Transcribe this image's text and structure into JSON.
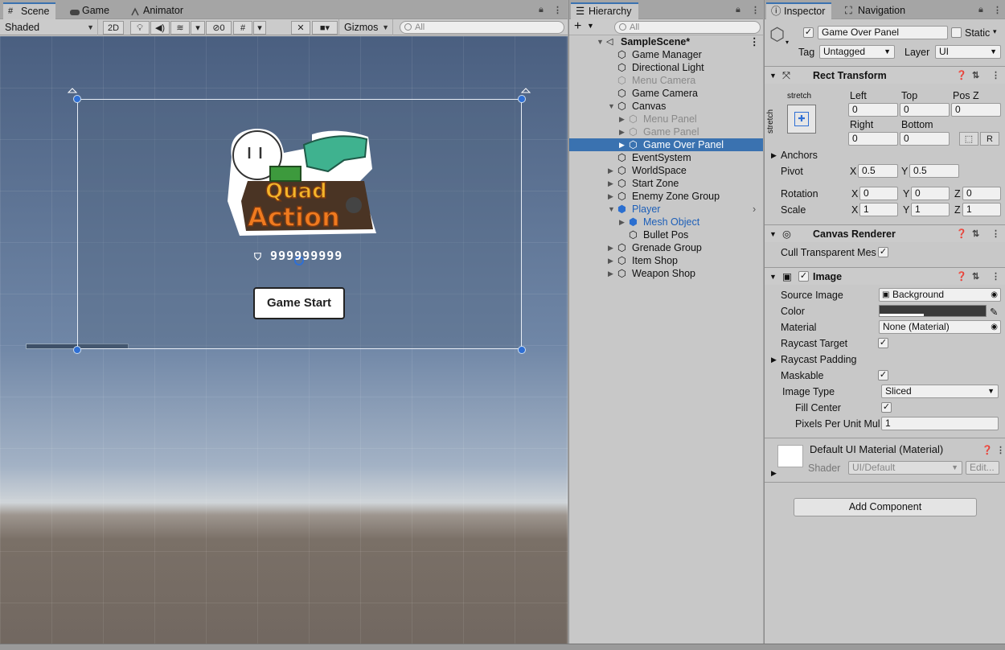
{
  "scene": {
    "tabs": [
      {
        "label": "Scene",
        "icon": "grid-icon"
      },
      {
        "label": "Game",
        "icon": "gamepad-icon"
      },
      {
        "label": "Animator",
        "icon": "animator-icon"
      }
    ],
    "shading": "Shaded",
    "mode2d": "2D",
    "gizmo_count": "0",
    "gizmos": "Gizmos",
    "search_placeholder": "All",
    "game_ui": {
      "score": "999999999",
      "start_button": "Game Start",
      "logo_top": "Quad",
      "logo_bottom": "Action"
    }
  },
  "hierarchy": {
    "title": "Hierarchy",
    "search_placeholder": "All",
    "scene_name": "SampleScene*",
    "items": [
      {
        "label": "Game Manager"
      },
      {
        "label": "Directional Light"
      },
      {
        "label": "Menu Camera"
      },
      {
        "label": "Game Camera"
      },
      {
        "label": "Canvas"
      },
      {
        "label": "Menu Panel"
      },
      {
        "label": "Game Panel"
      },
      {
        "label": "Game Over Panel"
      },
      {
        "label": "EventSystem"
      },
      {
        "label": "WorldSpace"
      },
      {
        "label": "Start Zone"
      },
      {
        "label": "Enemy Zone Group"
      },
      {
        "label": "Player"
      },
      {
        "label": "Mesh Object"
      },
      {
        "label": "Bullet Pos"
      },
      {
        "label": "Grenade Group"
      },
      {
        "label": "Item Shop"
      },
      {
        "label": "Weapon Shop"
      }
    ]
  },
  "inspector": {
    "tabs": [
      {
        "label": "Inspector"
      },
      {
        "label": "Navigation"
      }
    ],
    "object_name": "Game Over Panel",
    "static_label": "Static",
    "tag_label": "Tag",
    "tag_value": "Untagged",
    "layer_label": "Layer",
    "layer_value": "UI",
    "rect_transform": {
      "title": "Rect Transform",
      "stretch_h": "stretch",
      "stretch_v": "stretch",
      "left_label": "Left",
      "left": "0",
      "top_label": "Top",
      "top": "0",
      "posz_label": "Pos Z",
      "posz": "0",
      "right_label": "Right",
      "right": "0",
      "bottom_label": "Bottom",
      "bottom": "0",
      "r_button": "R",
      "anchors": "Anchors",
      "pivot": "Pivot",
      "pivot_x": "0.5",
      "pivot_y": "0.5",
      "rotation": "Rotation",
      "rot_x": "0",
      "rot_y": "0",
      "rot_z": "0",
      "scale": "Scale",
      "scale_x": "1",
      "scale_y": "1",
      "scale_z": "1",
      "x": "X",
      "y": "Y",
      "z": "Z"
    },
    "canvas_renderer": {
      "title": "Canvas Renderer",
      "cull": "Cull Transparent Mes"
    },
    "image": {
      "title": "Image",
      "source_image": "Source Image",
      "source_value": "Background",
      "color": "Color",
      "material": "Material",
      "material_value": "None (Material)",
      "raycast_target": "Raycast Target",
      "raycast_padding": "Raycast Padding",
      "maskable": "Maskable",
      "image_type": "Image Type",
      "image_type_value": "Sliced",
      "fill_center": "Fill Center",
      "ppu": "Pixels Per Unit Mul",
      "ppu_value": "1"
    },
    "material_block": {
      "title": "Default UI Material (Material)",
      "shader": "Shader",
      "shader_value": "UI/Default",
      "edit": "Edit..."
    },
    "add_component": "Add Component"
  }
}
